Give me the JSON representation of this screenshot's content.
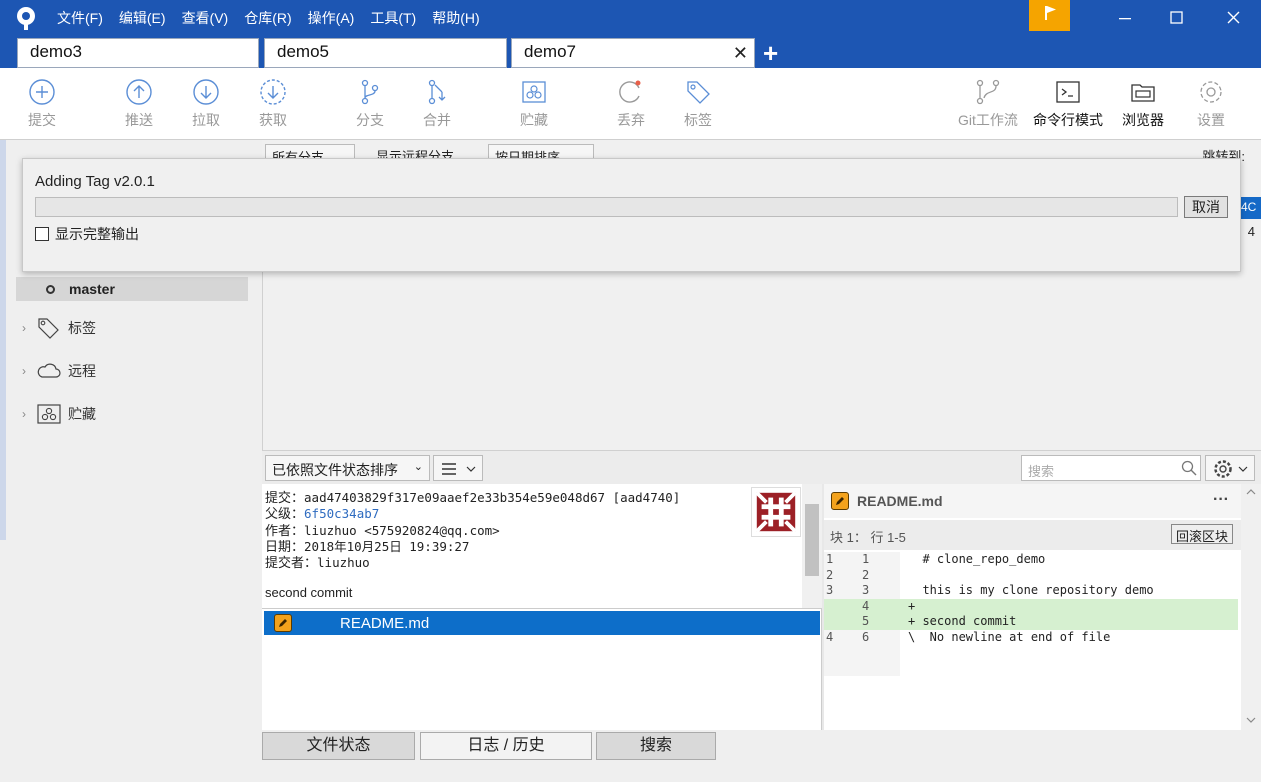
{
  "menu": [
    "文件(F)",
    "编辑(E)",
    "查看(V)",
    "仓库(R)",
    "操作(A)",
    "工具(T)",
    "帮助(H)"
  ],
  "tabs": [
    {
      "label": "demo3"
    },
    {
      "label": "demo5"
    },
    {
      "label": "demo7",
      "active": true
    }
  ],
  "toolbar": {
    "commit": "提交",
    "push": "推送",
    "pull": "拉取",
    "fetch": "获取",
    "branch": "分支",
    "merge": "合并",
    "stash": "贮藏",
    "discard": "丢弃",
    "tag": "标签",
    "gitflow": "Git工作流",
    "terminal": "命令行模式",
    "explorer": "浏览器",
    "settings": "设置"
  },
  "sidebar": {
    "branch": "master",
    "tags": "标签",
    "remotes": "远程",
    "stashes": "贮藏"
  },
  "filters": {
    "branches": "所有分支",
    "show_remote": "显示远程分支",
    "order": "按日期排序",
    "jump_to": "跳转到:"
  },
  "graph": {
    "selected_stub": "4C",
    "row2_stub": "4"
  },
  "dialog": {
    "title": "Adding Tag v2.0.1",
    "cancel": "取消",
    "show_full_output": "显示完整输出",
    "progress": 0
  },
  "lower": {
    "sort": "已依照文件状态排序",
    "search_placeholder": "搜索"
  },
  "commit": {
    "commit_label": "提交：",
    "commit_value": "aad47403829f317e09aaef2e33b354e59e048d67 [aad4740]",
    "parent_label": "父级：",
    "parent_value": "6f50c34ab7",
    "author_label": "作者：",
    "author_value": "liuzhuo <575920824@qq.com>",
    "date_label": "日期：",
    "date_value": "2018年10月25日 19:39:27",
    "committer_label": "提交者：",
    "committer_value": "liuzhuo",
    "message": "second commit"
  },
  "files": [
    {
      "name": "README.md",
      "status": "modified"
    }
  ],
  "diff": {
    "file": "README.md",
    "more": "···",
    "hunk": "块 1： 行 1-5",
    "revert": "回滚区块",
    "lines": [
      {
        "old": "1",
        "new": "1",
        "text": "  # clone_repo_demo",
        "type": "ctx"
      },
      {
        "old": "2",
        "new": "2",
        "text": "",
        "type": "ctx"
      },
      {
        "old": "3",
        "new": "3",
        "text": "  this is my clone repository demo",
        "type": "ctx"
      },
      {
        "old": "",
        "new": "4",
        "text": "+",
        "type": "add"
      },
      {
        "old": "",
        "new": "5",
        "text": "+ second commit",
        "type": "add"
      },
      {
        "old": "4",
        "new": "6",
        "text": "\\  No newline at end of file",
        "type": "ctx"
      }
    ]
  },
  "bottom_tabs": [
    "文件状态",
    "日志 / 历史",
    "搜索"
  ],
  "colors": {
    "titlebar": "#1d56b3",
    "accent_flag": "#f5a400",
    "selection": "#0d6ec9",
    "diff_add": "#d6f0d0"
  }
}
